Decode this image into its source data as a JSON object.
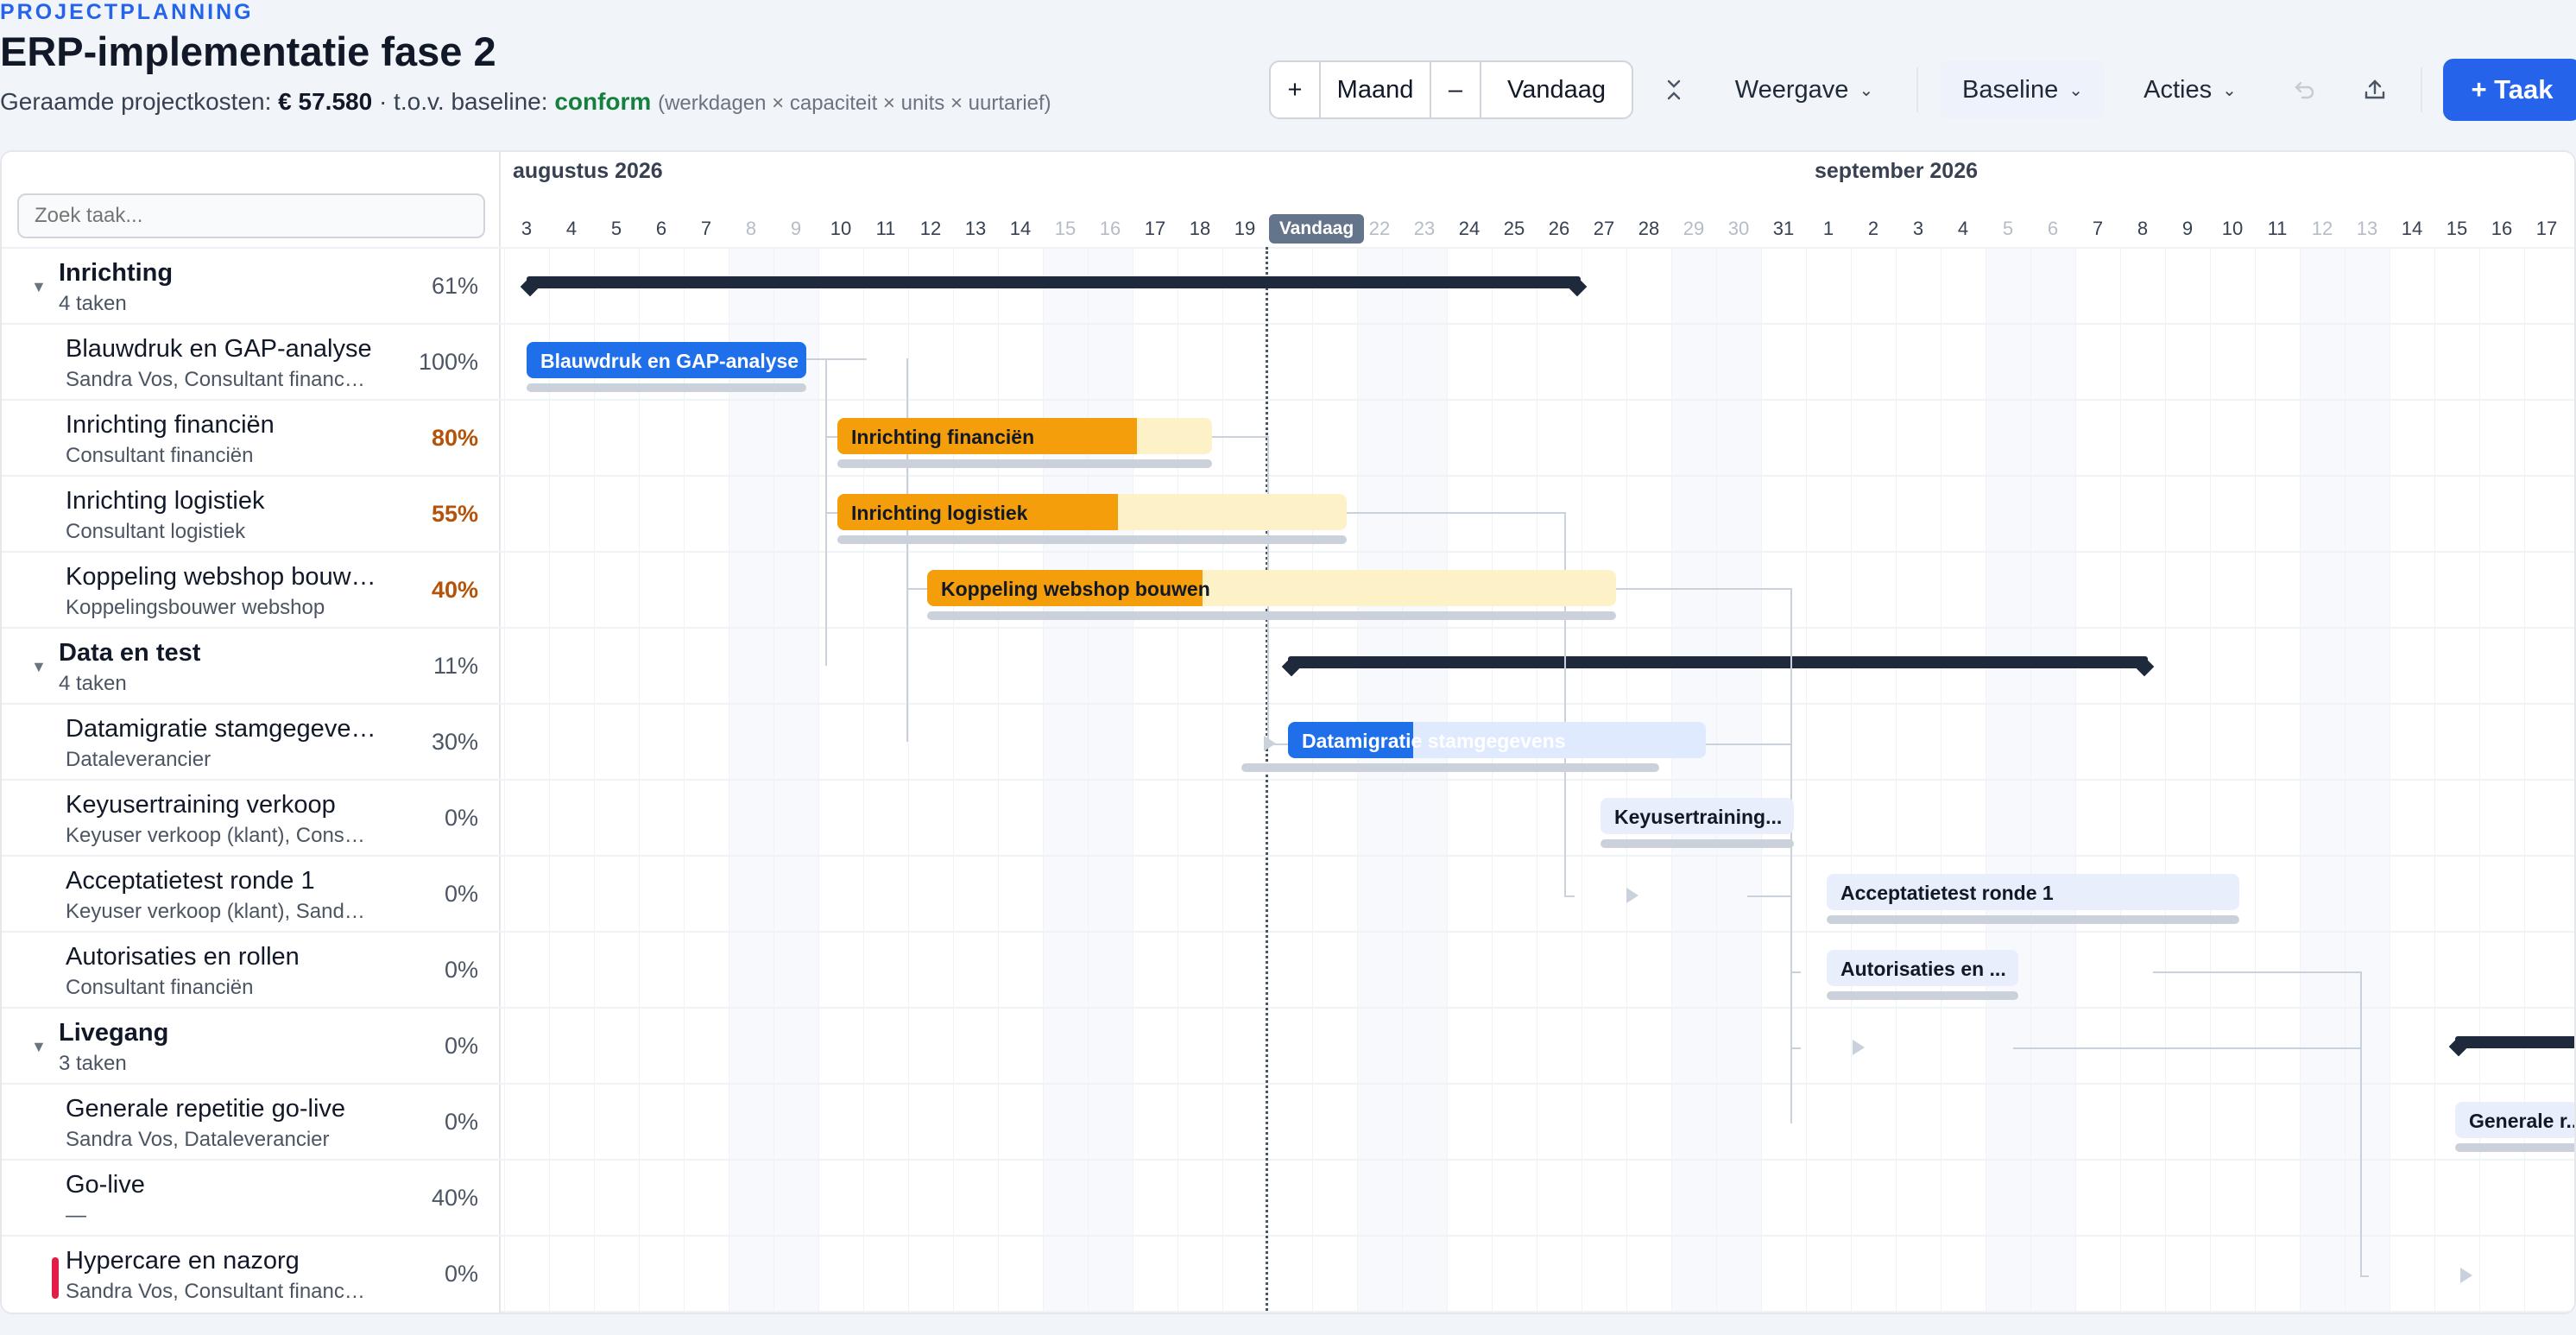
{
  "header": {
    "eyebrow": "PROJECTPLANNING",
    "title": "ERP-implementatie fase 2",
    "cost_label": "Geraamde projectkosten:",
    "cost_value": "€ 57.580",
    "baseline_label": "· t.o.v. baseline:",
    "baseline_status": "conform",
    "cost_hint": "(werkdagen × capaciteit × units × uurtarief)"
  },
  "toolbar": {
    "zoom_in": "+",
    "scale": "Maand",
    "zoom_out": "–",
    "today": "Vandaag",
    "collapse_icon": "collapse-icon",
    "view": "Weergave",
    "baseline": "Baseline",
    "actions": "Acties",
    "undo_icon": "undo-icon",
    "export_icon": "export-icon",
    "add_task": "+ Taak"
  },
  "search": {
    "placeholder": "Zoek taak..."
  },
  "timeline": {
    "months": [
      "augustus 2026",
      "september 2026"
    ],
    "days": [
      "3",
      "4",
      "5",
      "6",
      "7",
      "8",
      "9",
      "10",
      "11",
      "12",
      "13",
      "14",
      "15",
      "16",
      "17",
      "18",
      "19",
      "20",
      "21",
      "22",
      "23",
      "24",
      "25",
      "26",
      "27",
      "28",
      "29",
      "30",
      "31",
      "1",
      "2",
      "3",
      "4",
      "5",
      "6",
      "7",
      "8",
      "9",
      "10",
      "11",
      "12",
      "13",
      "14",
      "15",
      "16",
      "17"
    ],
    "today_label": "Vandaag"
  },
  "tasks": [
    {
      "name": "Inrichting",
      "sub": "4 taken",
      "pct": "61%",
      "group": true
    },
    {
      "name": "Blauwdruk en GAP-analyse",
      "sub": "Sandra Vos, Consultant financiën",
      "pct": "100%"
    },
    {
      "name": "Inrichting financiën",
      "sub": "Consultant financiën",
      "pct": "80%"
    },
    {
      "name": "Inrichting logistiek",
      "sub": "Consultant logistiek",
      "pct": "55%"
    },
    {
      "name": "Koppeling webshop bouwen",
      "sub": "Koppelingsbouwer webshop",
      "pct": "40%"
    },
    {
      "name": "Data en test",
      "sub": "4 taken",
      "pct": "11%",
      "group": true
    },
    {
      "name": "Datamigratie stamgegevens",
      "sub": "Dataleverancier",
      "pct": "30%"
    },
    {
      "name": "Keyusertraining verkoop",
      "sub": "Keyuser verkoop (klant), Consultant",
      "pct": "0%"
    },
    {
      "name": "Acceptatietest ronde 1",
      "sub": "Keyuser verkoop (klant), Sandra Vos",
      "pct": "0%"
    },
    {
      "name": "Autorisaties en rollen",
      "sub": "Consultant financiën",
      "pct": "0%"
    },
    {
      "name": "Livegang",
      "sub": "3 taken",
      "pct": "0%",
      "group": true
    },
    {
      "name": "Generale repetitie go-live",
      "sub": "Sandra Vos, Dataleverancier",
      "pct": "0%"
    },
    {
      "name": "Go-live",
      "sub": "—",
      "pct": "40%"
    },
    {
      "name": "Hypercare en nazorg",
      "sub": "Sandra Vos, Consultant financiën",
      "pct": "0%"
    }
  ],
  "bars": {
    "b1": "Blauwdruk en GAP-analyse",
    "b2": "Inrichting financiën",
    "b3": "Inrichting logistiek",
    "b4": "Koppeling webshop bouwen",
    "b6": "Datamigratie stamgegevens",
    "b7": "Keyusertraining...",
    "b8": "Acceptatietest ronde 1",
    "b9": "Autorisaties en ...",
    "b11": "Generale r..."
  },
  "colors": {
    "accent": "#2563eb",
    "progress_blue": "#1f6feb",
    "progress_amber": "#f59e0b",
    "summary": "#1e293b",
    "status_ok": "#15803d"
  }
}
